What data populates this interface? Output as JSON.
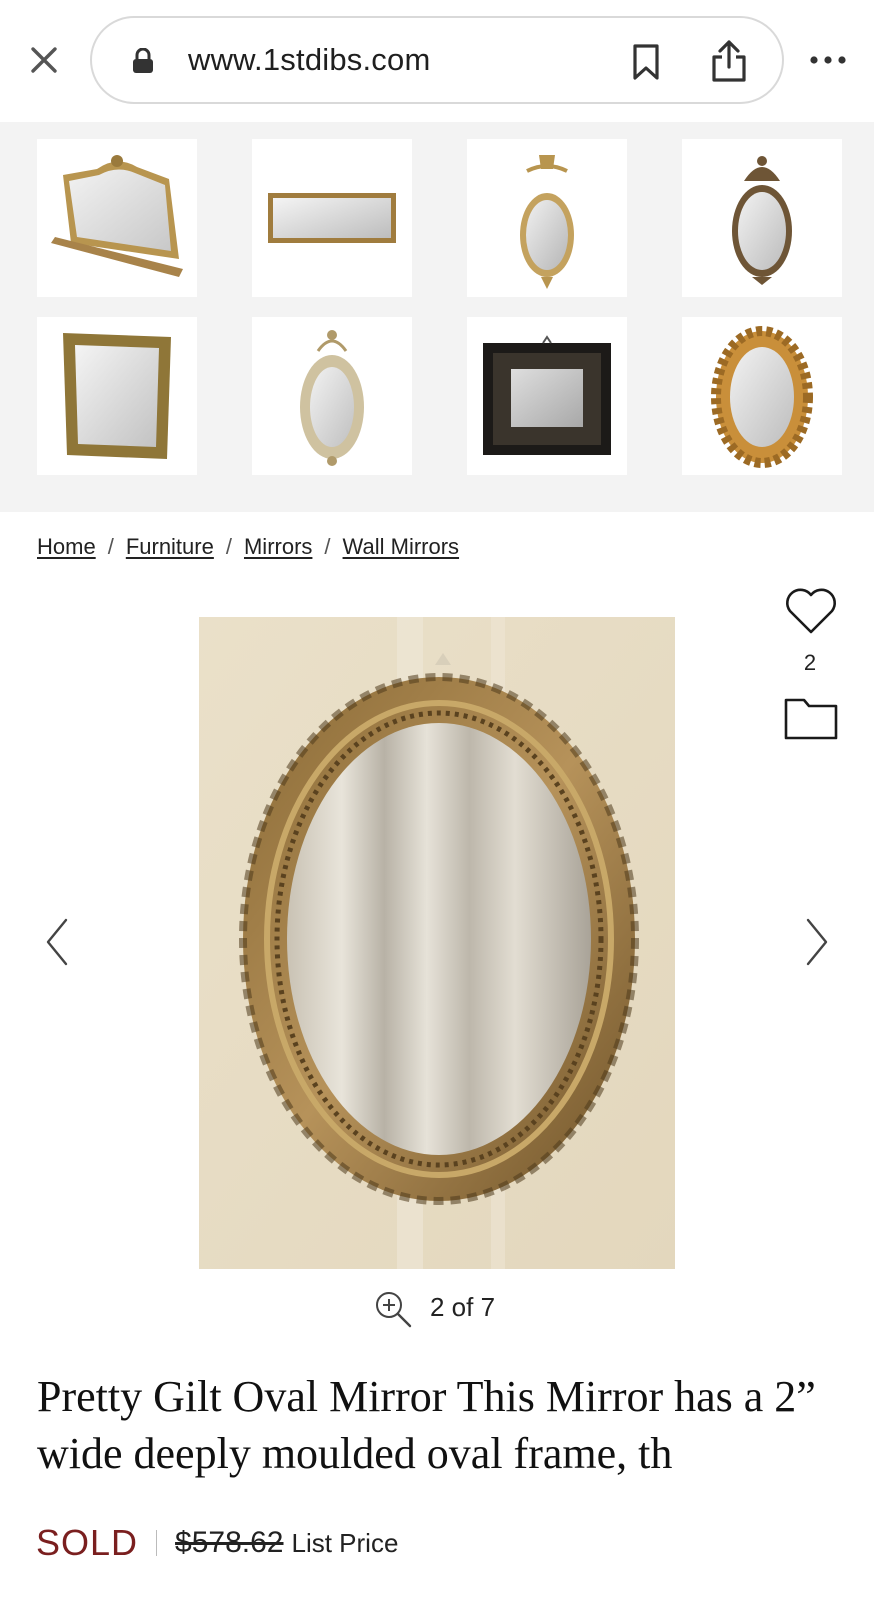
{
  "browser": {
    "url": "www.1stdibs.com",
    "icons": [
      "close-icon",
      "lock-icon",
      "bookmark-icon",
      "share-icon",
      "more-icon"
    ]
  },
  "thumbnails": [
    {
      "name": "thumb-overmantel-mirror",
      "icon": "mirror-thumbnail"
    },
    {
      "name": "thumb-rectangular-mirror",
      "icon": "mirror-thumbnail"
    },
    {
      "name": "thumb-urn-oval-mirror",
      "icon": "mirror-thumbnail"
    },
    {
      "name": "thumb-carved-oval-mirror",
      "icon": "mirror-thumbnail"
    },
    {
      "name": "thumb-gilt-rectangle-mirror",
      "icon": "mirror-thumbnail"
    },
    {
      "name": "thumb-sectional-oval-mirror",
      "icon": "mirror-thumbnail"
    },
    {
      "name": "thumb-black-frame-mirror",
      "icon": "mirror-thumbnail"
    },
    {
      "name": "thumb-ball-frame-mirror",
      "icon": "mirror-thumbnail"
    }
  ],
  "breadcrumb": {
    "items": [
      "Home",
      "Furniture",
      "Mirrors",
      "Wall Mirrors"
    ],
    "separator": "/"
  },
  "gallery": {
    "favorite_count": "2",
    "counter": "2 of 7"
  },
  "product": {
    "title": "Pretty Gilt Oval Mirror This Mirror has a 2” wide deeply moulded oval frame, th",
    "status": "SOLD",
    "price": "$578.62",
    "price_label": "List Price"
  },
  "colors": {
    "sold": "#7a1f1f",
    "thumb_bg": "#f3f3f3",
    "gilt": "#a8834a"
  }
}
